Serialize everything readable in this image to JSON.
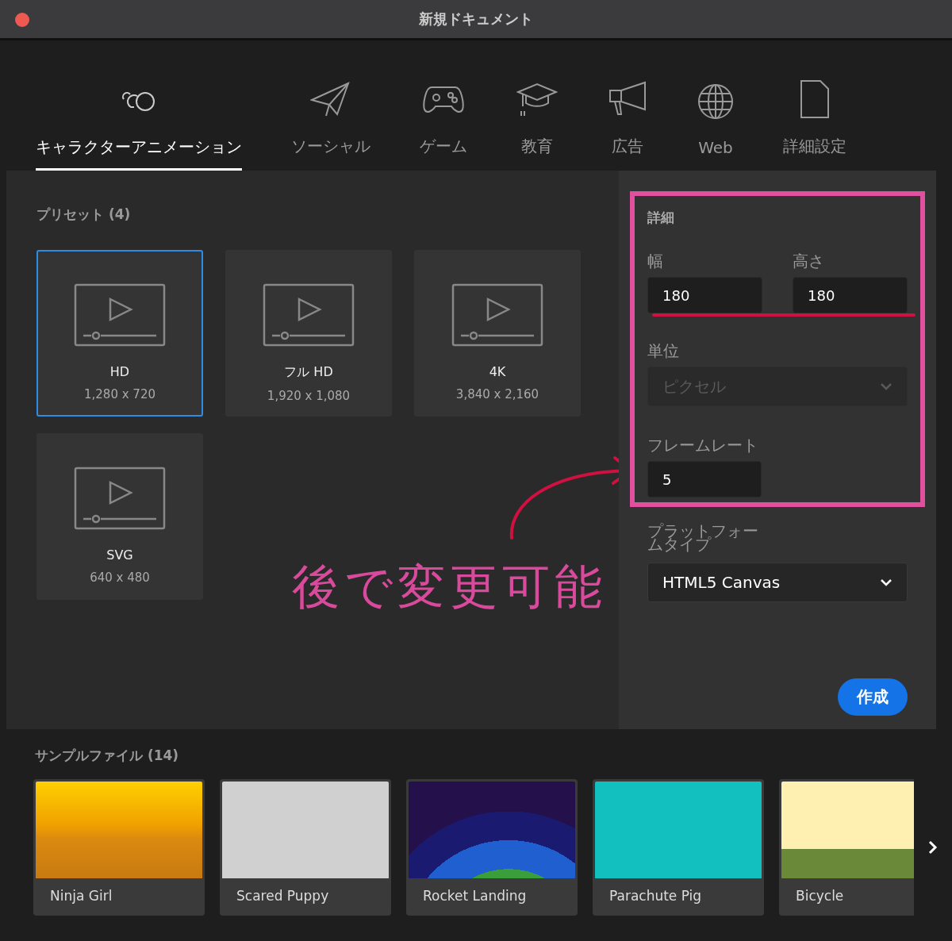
{
  "window": {
    "title": "新規ドキュメント"
  },
  "tabs": [
    {
      "label": "キャラクターアニメーション",
      "kind": "character",
      "selected": true
    },
    {
      "label": "ソーシャル",
      "kind": "social",
      "selected": false
    },
    {
      "label": "ゲーム",
      "kind": "game",
      "selected": false
    },
    {
      "label": "教育",
      "kind": "education",
      "selected": false
    },
    {
      "label": "広告",
      "kind": "ad",
      "selected": false
    },
    {
      "label": "Web",
      "kind": "web",
      "selected": false
    },
    {
      "label": "詳細設定",
      "kind": "advanced",
      "selected": false
    }
  ],
  "presets": {
    "heading": "プリセット (4)",
    "items": [
      {
        "name": "HD",
        "size": "1,280 x 720",
        "selected": true
      },
      {
        "name": "フル HD",
        "size": "1,920 x 1,080",
        "selected": false
      },
      {
        "name": "4K",
        "size": "3,840 x 2,160",
        "selected": false
      },
      {
        "name": "SVG",
        "size": "640 x 480",
        "selected": false
      }
    ]
  },
  "annotation": {
    "text": "後で変更可能"
  },
  "details": {
    "heading": "詳細",
    "width": {
      "label": "幅",
      "value": "180"
    },
    "height": {
      "label": "高さ",
      "value": "180"
    },
    "unit": {
      "label": "単位",
      "value": "ピクセル",
      "disabled": true
    },
    "frame_rate": {
      "label": "フレームレート",
      "value": "5"
    },
    "platform": {
      "label": "プラットフォームタイプ",
      "value": "HTML5 Canvas"
    },
    "create_button": "作成"
  },
  "samples": {
    "heading": "サンプルファイル (14)",
    "items": [
      {
        "title": "Ninja Girl",
        "kind": "ninja"
      },
      {
        "title": "Scared Puppy",
        "kind": "puppy"
      },
      {
        "title": "Rocket Landing",
        "kind": "rocket"
      },
      {
        "title": "Parachute Pig",
        "kind": "pig"
      },
      {
        "title": "Bicycle",
        "kind": "bicycle"
      }
    ]
  }
}
